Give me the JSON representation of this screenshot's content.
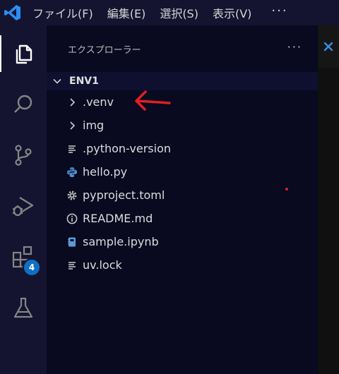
{
  "menubar": {
    "items": [
      "ファイル(F)",
      "編集(E)",
      "選択(S)",
      "表示(V)"
    ],
    "more": "···"
  },
  "activity_bar": {
    "items": [
      {
        "icon": "files-icon",
        "active": true
      },
      {
        "icon": "search-icon"
      },
      {
        "icon": "source-control-icon"
      },
      {
        "icon": "run-debug-icon"
      },
      {
        "icon": "extensions-icon",
        "badge": "4"
      },
      {
        "icon": "testing-flask-icon"
      }
    ]
  },
  "explorer": {
    "title": "エクスプローラー",
    "more": "···",
    "folder": "ENV1",
    "items": [
      {
        "label": ".venv",
        "type": "folder",
        "icon": "chevron-right-icon"
      },
      {
        "label": "img",
        "type": "folder",
        "icon": "chevron-right-icon"
      },
      {
        "label": ".python-version",
        "type": "file",
        "icon": "lines-icon"
      },
      {
        "label": "hello.py",
        "type": "file",
        "icon": "python-icon"
      },
      {
        "label": "pyproject.toml",
        "type": "file",
        "icon": "gear-icon"
      },
      {
        "label": "README.md",
        "type": "file",
        "icon": "info-icon"
      },
      {
        "label": "sample.ipynb",
        "type": "file",
        "icon": "notebook-icon"
      },
      {
        "label": "uv.lock",
        "type": "file",
        "icon": "lines-icon"
      }
    ]
  },
  "colors": {
    "accent": "#0f6fc6",
    "arrow": "#e02020",
    "python": "#3f7fbf"
  }
}
